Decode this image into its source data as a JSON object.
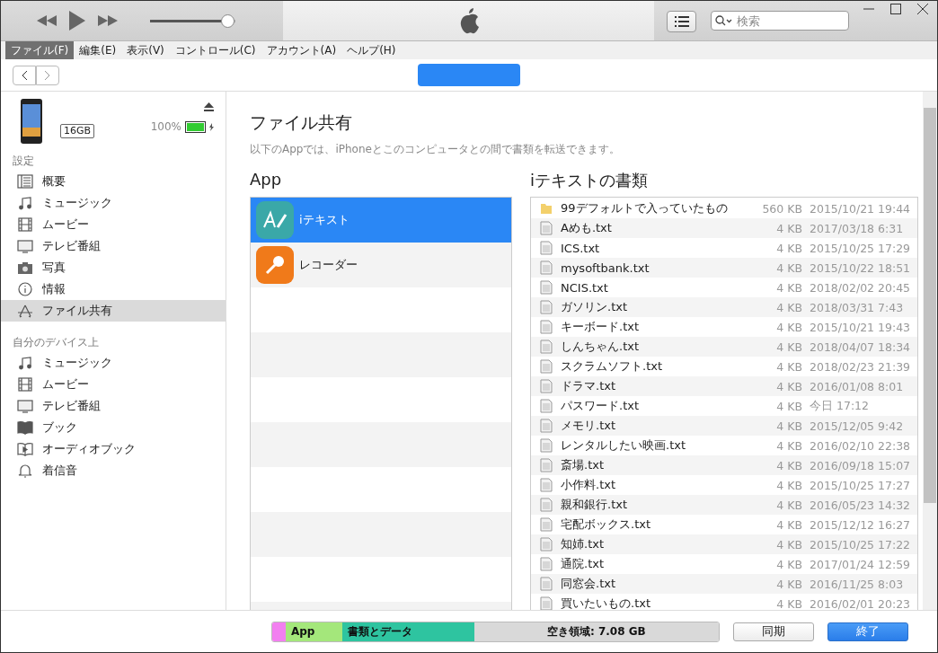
{
  "player": {
    "volume": {
      "level": 0.92
    }
  },
  "search": {
    "placeholder": "検索"
  },
  "menu": [
    {
      "label": "ファイル(F)",
      "selected": true
    },
    {
      "label": "編集(E)",
      "selected": false
    },
    {
      "label": "表示(V)",
      "selected": false
    },
    {
      "label": "コントロール(C)",
      "selected": false
    },
    {
      "label": "アカウント(A)",
      "selected": false
    },
    {
      "label": "ヘルプ(H)",
      "selected": false
    }
  ],
  "device": {
    "capacity": "16GB",
    "battery": "100%",
    "battery_level": {
      "level": 1
    }
  },
  "sidebar": [
    {
      "heading": "設定",
      "items": [
        {
          "label": "概要",
          "kind": "summary",
          "selected": false
        },
        {
          "label": "ミュージック",
          "kind": "music",
          "selected": false
        },
        {
          "label": "ムービー",
          "kind": "movie",
          "selected": false
        },
        {
          "label": "テレビ番組",
          "kind": "tv",
          "selected": false
        },
        {
          "label": "写真",
          "kind": "photo",
          "selected": false
        },
        {
          "label": "情報",
          "kind": "info",
          "selected": false
        },
        {
          "label": "ファイル共有",
          "kind": "apps",
          "selected": true
        }
      ]
    },
    {
      "heading": "自分のデバイス上",
      "items": [
        {
          "label": "ミュージック",
          "kind": "music",
          "selected": false
        },
        {
          "label": "ムービー",
          "kind": "movie",
          "selected": false
        },
        {
          "label": "テレビ番組",
          "kind": "tv",
          "selected": false
        },
        {
          "label": "ブック",
          "kind": "book",
          "selected": false
        },
        {
          "label": "オーディオブック",
          "kind": "audiobook",
          "selected": false
        },
        {
          "label": "着信音",
          "kind": "tone",
          "selected": false
        }
      ]
    }
  ],
  "content": {
    "title": "ファイル共有",
    "description": "以下のAppでは、iPhoneとこのコンピュータとの間で書類を転送できます。",
    "apps_heading": "App",
    "docs_heading": "iテキストの書類"
  },
  "apps": [
    {
      "name": "iテキスト",
      "kind": "text",
      "selected": true
    },
    {
      "name": "レコーダー",
      "kind": "recorder",
      "selected": false
    }
  ],
  "documents": [
    {
      "name": "99デフォルトで入っていたもの",
      "kind": "folder",
      "size": "560 KB",
      "date": "2015/10/21 19:44"
    },
    {
      "name": "Aめも.txt",
      "kind": "file",
      "size": "4 KB",
      "date": "2017/03/18 6:31"
    },
    {
      "name": "ICS.txt",
      "kind": "file",
      "size": "4 KB",
      "date": "2015/10/25 17:29"
    },
    {
      "name": "mysoftbank.txt",
      "kind": "file",
      "size": "4 KB",
      "date": "2015/10/22 18:51"
    },
    {
      "name": "NCIS.txt",
      "kind": "file",
      "size": "4 KB",
      "date": "2018/02/02 20:45"
    },
    {
      "name": "ガソリン.txt",
      "kind": "file",
      "size": "4 KB",
      "date": "2018/03/31 7:43"
    },
    {
      "name": "キーボード.txt",
      "kind": "file",
      "size": "4 KB",
      "date": "2015/10/21 19:43"
    },
    {
      "name": "しんちゃん.txt",
      "kind": "file",
      "size": "4 KB",
      "date": "2018/04/07 18:34"
    },
    {
      "name": "スクラムソフト.txt",
      "kind": "file",
      "size": "4 KB",
      "date": "2018/02/23 21:39"
    },
    {
      "name": "ドラマ.txt",
      "kind": "file",
      "size": "4 KB",
      "date": "2016/01/08 8:01"
    },
    {
      "name": "パスワード.txt",
      "kind": "file",
      "size": "4 KB",
      "date": "今日 17:12"
    },
    {
      "name": "メモリ.txt",
      "kind": "file",
      "size": "4 KB",
      "date": "2015/12/05 9:42"
    },
    {
      "name": "レンタルしたい映画.txt",
      "kind": "file",
      "size": "4 KB",
      "date": "2016/02/10 22:38"
    },
    {
      "name": "斎場.txt",
      "kind": "file",
      "size": "4 KB",
      "date": "2016/09/18 15:07"
    },
    {
      "name": "小作料.txt",
      "kind": "file",
      "size": "4 KB",
      "date": "2015/10/25 17:27"
    },
    {
      "name": "親和銀行.txt",
      "kind": "file",
      "size": "4 KB",
      "date": "2016/05/23 14:32"
    },
    {
      "name": "宅配ボックス.txt",
      "kind": "file",
      "size": "4 KB",
      "date": "2015/12/12 16:27"
    },
    {
      "name": "知姉.txt",
      "kind": "file",
      "size": "4 KB",
      "date": "2015/10/25 17:22"
    },
    {
      "name": "通院.txt",
      "kind": "file",
      "size": "4 KB",
      "date": "2017/01/24 12:59"
    },
    {
      "name": "同窓会.txt",
      "kind": "file",
      "size": "4 KB",
      "date": "2016/11/25 8:03"
    },
    {
      "name": "買いたいもの.txt",
      "kind": "file",
      "size": "4 KB",
      "date": "2016/02/01 20:23"
    }
  ],
  "storage": [
    {
      "color": "#f27ff0",
      "level": 0.03
    },
    {
      "label": "App",
      "color": "#a4e77b",
      "level": 0.126
    },
    {
      "label": "書類とデータ",
      "color": "#2ec4a0",
      "level": 0.296
    },
    {
      "label": "空き領域: 7.08 GB",
      "color": "#d9d9d9",
      "level": 0.548
    }
  ],
  "buttons": [
    {
      "label": "同期",
      "kind": "secondary"
    },
    {
      "label": "終了",
      "kind": "primary"
    }
  ]
}
